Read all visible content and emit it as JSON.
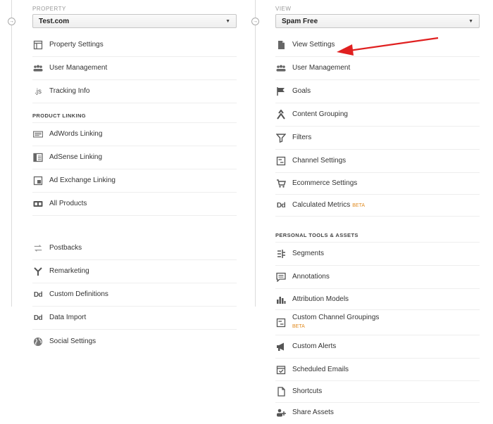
{
  "property": {
    "label": "PROPERTY",
    "selected": "Test.com",
    "items_top": [
      {
        "label": "Property Settings",
        "icon": "property-settings-icon"
      },
      {
        "label": "User Management",
        "icon": "users-icon"
      },
      {
        "label": "Tracking Info",
        "icon": "js-icon"
      }
    ],
    "section_label": "PRODUCT LINKING",
    "items_linking": [
      {
        "label": "AdWords Linking",
        "icon": "adwords-icon"
      },
      {
        "label": "AdSense Linking",
        "icon": "adsense-icon"
      },
      {
        "label": "Ad Exchange Linking",
        "icon": "ad-exchange-icon"
      },
      {
        "label": "All Products",
        "icon": "all-products-icon"
      }
    ],
    "items_bottom": [
      {
        "label": "Postbacks",
        "icon": "postbacks-icon"
      },
      {
        "label": "Remarketing",
        "icon": "remarketing-icon"
      },
      {
        "label": "Custom Definitions",
        "icon": "dd-icon"
      },
      {
        "label": "Data Import",
        "icon": "dd-icon"
      },
      {
        "label": "Social Settings",
        "icon": "globe-icon"
      }
    ]
  },
  "view": {
    "label": "VIEW",
    "selected": "Spam Free",
    "items_top": [
      {
        "label": "View Settings",
        "icon": "document-icon"
      },
      {
        "label": "User Management",
        "icon": "users-icon"
      },
      {
        "label": "Goals",
        "icon": "flag-icon"
      },
      {
        "label": "Content Grouping",
        "icon": "content-grouping-icon"
      },
      {
        "label": "Filters",
        "icon": "filter-icon"
      },
      {
        "label": "Channel Settings",
        "icon": "channel-settings-icon"
      },
      {
        "label": "Ecommerce Settings",
        "icon": "cart-icon"
      },
      {
        "label": "Calculated Metrics",
        "icon": "dd-icon",
        "badge": "BETA"
      }
    ],
    "section_label": "PERSONAL TOOLS & ASSETS",
    "items_tools": [
      {
        "label": "Segments",
        "icon": "segments-icon"
      },
      {
        "label": "Annotations",
        "icon": "annotations-icon"
      },
      {
        "label": "Attribution Models",
        "icon": "attribution-icon"
      },
      {
        "label": "Custom Channel Groupings",
        "icon": "channel-settings-icon",
        "badge": "BETA"
      },
      {
        "label": "Custom Alerts",
        "icon": "megaphone-icon"
      },
      {
        "label": "Scheduled Emails",
        "icon": "scheduled-emails-icon"
      },
      {
        "label": "Shortcuts",
        "icon": "shortcuts-icon"
      },
      {
        "label": "Share Assets",
        "icon": "share-assets-icon"
      }
    ]
  },
  "colors": {
    "beta": "#e08a1e",
    "arrow": "#e02020"
  }
}
